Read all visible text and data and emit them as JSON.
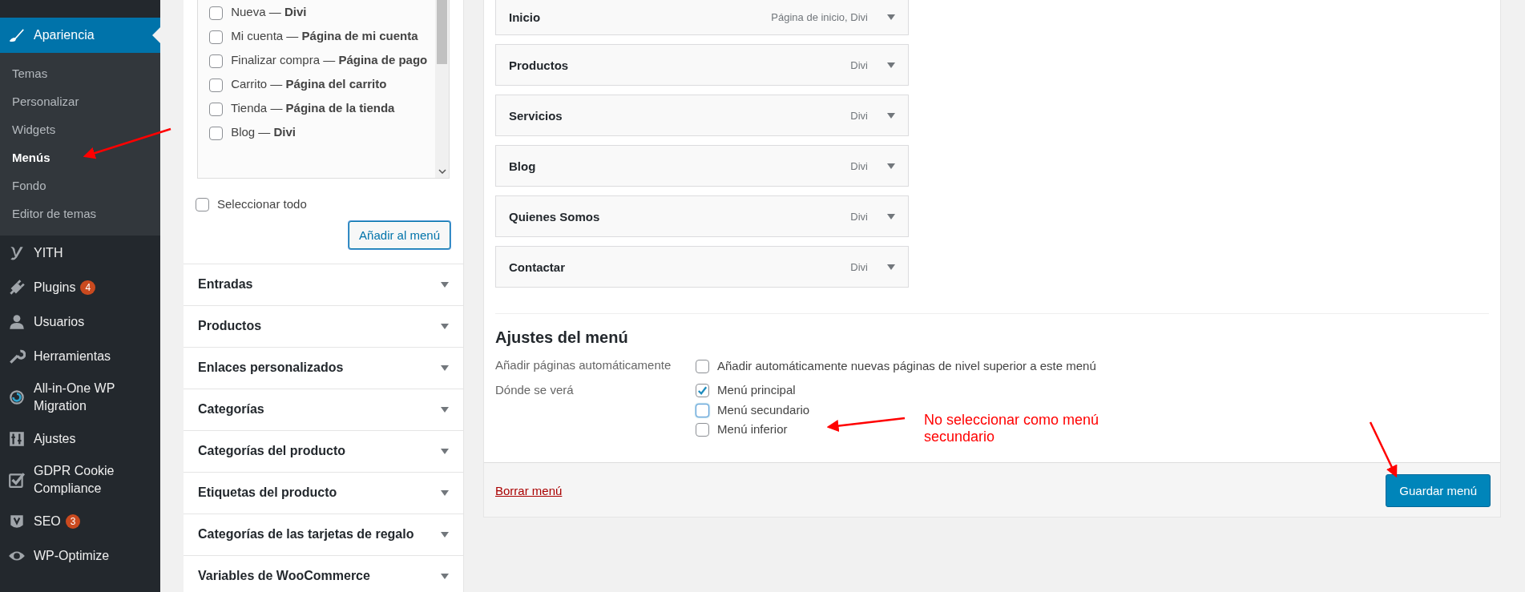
{
  "sidebar": {
    "current": {
      "label": "Apariencia",
      "selected": true
    },
    "submenu": [
      {
        "label": "Temas",
        "selected": false
      },
      {
        "label": "Personalizar",
        "selected": false
      },
      {
        "label": "Widgets",
        "selected": false
      },
      {
        "label": "Menús",
        "selected": true
      },
      {
        "label": "Fondo",
        "selected": false
      },
      {
        "label": "Editor de temas",
        "selected": false
      }
    ],
    "items": [
      {
        "label": "YITH"
      },
      {
        "label": "Plugins",
        "badge": "4"
      },
      {
        "label": "Usuarios"
      },
      {
        "label": "Herramientas"
      },
      {
        "label": "All-in-One WP Migration"
      },
      {
        "label": "Ajustes"
      },
      {
        "label": "GDPR Cookie Compliance"
      },
      {
        "label": "SEO",
        "badge": "3"
      },
      {
        "label": "WP-Optimize"
      }
    ]
  },
  "pages_box": {
    "items": [
      {
        "label": "Nueva — **Divi**",
        "checked": false
      },
      {
        "label": "Mi cuenta — **Página de mi cuenta**",
        "checked": false
      },
      {
        "label": "Finalizar compra — **Página de pago**",
        "checked": false
      },
      {
        "label": "Carrito — **Página del carrito**",
        "checked": false
      },
      {
        "label": "Tienda — **Página de la tienda**",
        "checked": false
      },
      {
        "label": "Blog — **Divi**",
        "checked": false
      }
    ],
    "select_all": {
      "label": "Seleccionar todo",
      "checked": false
    },
    "add_button": "Añadir al menú"
  },
  "sections": [
    {
      "label": "Entradas",
      "expanded": false
    },
    {
      "label": "Productos",
      "expanded": false
    },
    {
      "label": "Enlaces personalizados",
      "expanded": false
    },
    {
      "label": "Categorías",
      "expanded": false
    },
    {
      "label": "Categorías del producto",
      "expanded": false
    },
    {
      "label": "Etiquetas del producto",
      "expanded": false
    },
    {
      "label": "Categorías de las tarjetas de regalo",
      "expanded": false
    },
    {
      "label": "Variables de WooCommerce",
      "expanded": false
    }
  ],
  "menu_items": [
    {
      "title": "Inicio",
      "type": "Página de inicio, Divi",
      "expanded": false
    },
    {
      "title": "Productos",
      "type": "Divi",
      "expanded": false
    },
    {
      "title": "Servicios",
      "type": "Divi",
      "expanded": false
    },
    {
      "title": "Blog",
      "type": "Divi",
      "expanded": false
    },
    {
      "title": "Quienes Somos",
      "type": "Divi",
      "expanded": false
    },
    {
      "title": "Contactar",
      "type": "Divi",
      "expanded": false
    }
  ],
  "menu_settings": {
    "heading": "Ajustes del menú",
    "auto_add": {
      "label": "Añadir páginas automáticamente",
      "option": "Añadir automáticamente nuevas páginas de nivel superior a este menú",
      "checked": false
    },
    "locations": {
      "label": "Dónde se verá",
      "options": [
        {
          "label": "Menú principal",
          "checked": true,
          "focused": false
        },
        {
          "label": "Menú secundario",
          "checked": false,
          "focused": true
        },
        {
          "label": "Menú inferior",
          "checked": false,
          "focused": false
        }
      ]
    }
  },
  "footer": {
    "delete_link": "Borrar menú",
    "save_button": "Guardar menú"
  },
  "annotation": {
    "text": "No seleccionar como menú secundario"
  }
}
